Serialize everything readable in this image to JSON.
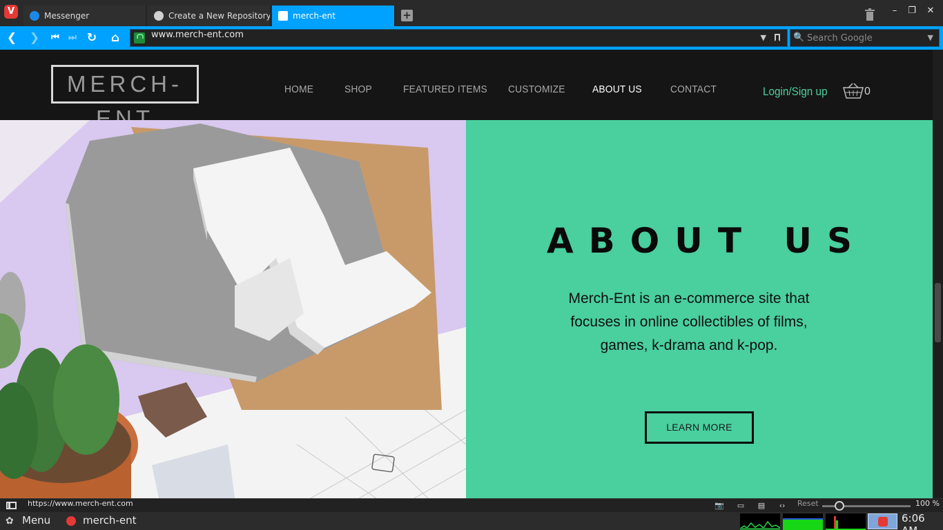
{
  "browser": {
    "tabs": [
      {
        "label": "Messenger",
        "icon": "messenger-icon"
      },
      {
        "label": "Create a New Repository",
        "icon": "github-icon"
      },
      {
        "label": "merch-ent",
        "icon": "page-icon",
        "active": true
      }
    ],
    "url": "www.merch-ent.com",
    "search_placeholder": "Search Google"
  },
  "site": {
    "logo": "MERCH-ENT",
    "nav": [
      "HOME",
      "SHOP",
      "FEATURED ITEMS",
      "CUSTOMIZE",
      "ABOUT US",
      "CONTACT"
    ],
    "active_nav": "ABOUT US",
    "login": "Login/Sign up",
    "cart_count": "0",
    "about_title": "ABOUT US",
    "about_text": "Merch-Ent is an e-commerce site that focuses in online collectibles of films, games, k-drama and k-pop.",
    "learn_more": "LEARN MORE",
    "accent_color": "#4acf9f"
  },
  "statusbar": {
    "hover_url": "https://www.merch-ent.com",
    "reset": "Reset",
    "zoom": "100 %"
  },
  "taskbar": {
    "menu": "Menu",
    "app": "merch-ent",
    "clock": "6:06 AM"
  }
}
